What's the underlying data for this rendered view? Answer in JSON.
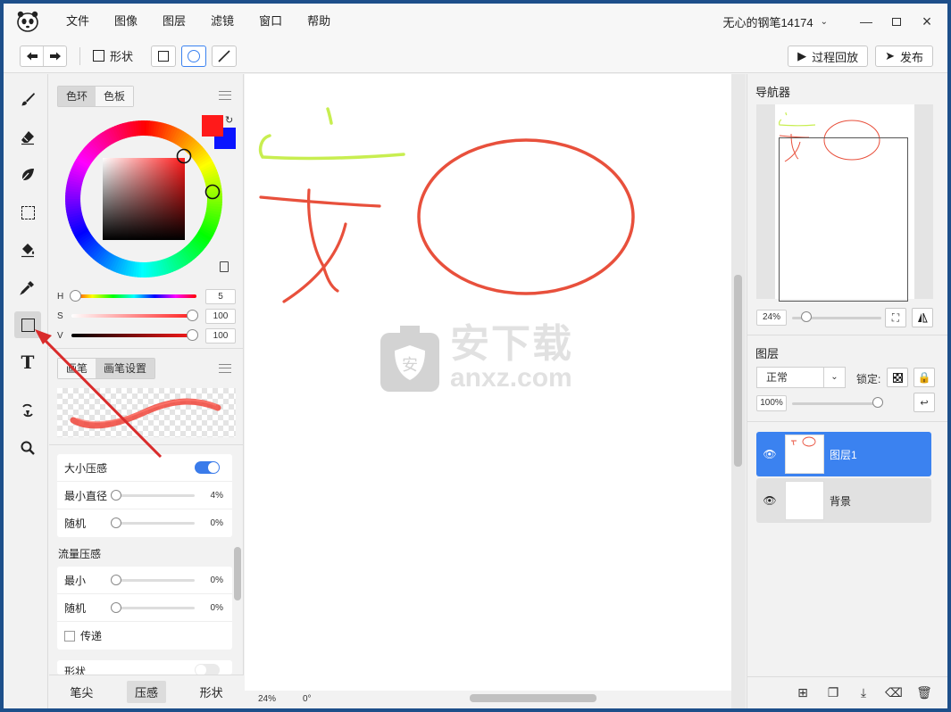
{
  "menu": [
    "文件",
    "图像",
    "图层",
    "滤镜",
    "窗口",
    "帮助"
  ],
  "doc_title": "无心的钢笔14174",
  "window_controls": [
    "minimize",
    "maximize",
    "close"
  ],
  "toolbar": {
    "shape_label": "形状",
    "replay_label": "过程回放",
    "publish_label": "发布"
  },
  "tools": [
    "brush-icon",
    "eraser-icon",
    "smudge-icon",
    "marquee-select-icon",
    "fill-bucket-icon",
    "eyedropper-icon",
    "rectangle-shape-icon",
    "text-icon",
    "transform-icon",
    "zoom-icon"
  ],
  "color_panel": {
    "tab_wheel": "色环",
    "tab_swatches": "色板",
    "primary_color": "#ff1a1a",
    "secondary_color": "#0a14ff",
    "h_label": "H",
    "h_value": "5",
    "s_label": "S",
    "s_value": "100",
    "v_label": "V",
    "v_value": "100"
  },
  "brush_panel": {
    "tab_brush": "画笔",
    "tab_settings": "画笔设置",
    "size_pressure": "大小压感",
    "min_diameter": "最小直径",
    "min_diameter_value": "4%",
    "random": "随机",
    "random_value": "0%",
    "flow_pressure": "流量压感",
    "flow_min": "最小",
    "flow_min_value": "0%",
    "flow_random": "随机",
    "flow_random_value": "0%",
    "transfer": "传递",
    "shape": "形状"
  },
  "bottom_tabs": [
    "笔尖",
    "压感",
    "形状"
  ],
  "status": {
    "zoom": "24%",
    "angle": "0°"
  },
  "watermark": {
    "cn": "安下载",
    "en": "anxz.com"
  },
  "navigator": {
    "title": "导航器",
    "zoom": "24%"
  },
  "layers_panel": {
    "title": "图层",
    "blend_mode": "正常",
    "lock_label": "锁定:",
    "opacity": "100%",
    "layers": [
      {
        "name": "图层1",
        "active": true
      },
      {
        "name": "背景",
        "active": false
      }
    ]
  },
  "colors": {
    "accent": "#3b82f0",
    "stroke_red": "#e8503c",
    "stroke_green": "#c8ee50"
  }
}
